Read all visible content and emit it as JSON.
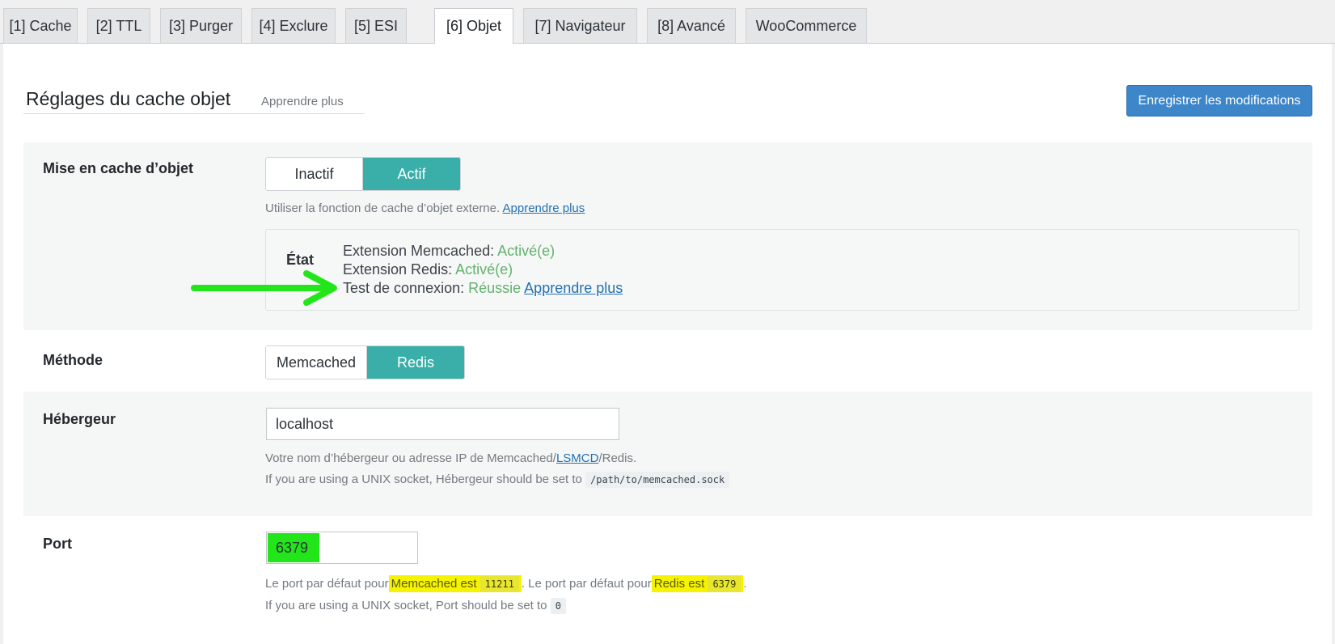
{
  "tabs": [
    {
      "label": "[1] Cache"
    },
    {
      "label": "[2] TTL"
    },
    {
      "label": "[3] Purger"
    },
    {
      "label": "[4] Exclure"
    },
    {
      "label": "[5] ESI"
    },
    {
      "label": "[6] Objet"
    },
    {
      "label": "[7] Navigateur"
    },
    {
      "label": "[8] Avancé"
    },
    {
      "label": "WooCommerce"
    }
  ],
  "active_tab": "[6] Objet",
  "header": {
    "title": "Réglages du cache objet",
    "learn_more": "Apprendre plus",
    "save_button": "Enregistrer les modifications"
  },
  "object_cache": {
    "label": "Mise en cache d’objet",
    "options": [
      "Inactif",
      "Actif"
    ],
    "selected": "Actif",
    "description": "Utiliser la fonction de cache d’objet externe.",
    "learn_more": "Apprendre plus",
    "status": {
      "title": "État",
      "memcached_label": "Extension Memcached:",
      "memcached_value": "Activé(e)",
      "redis_label": "Extension Redis:",
      "redis_value": "Activé(e)",
      "connection_label": "Test de connexion:",
      "connection_value": "Réussie",
      "learn_more": "Apprendre plus"
    }
  },
  "method": {
    "label": "Méthode",
    "options": [
      "Memcached",
      "Redis"
    ],
    "selected": "Redis"
  },
  "host": {
    "label": "Hébergeur",
    "value": "localhost",
    "desc_part1": "Votre nom d’hébergeur ou adresse IP de Memcached/",
    "desc_link": "LSMCD",
    "desc_part2": "/Redis.",
    "socket_text": "If you are using a UNIX socket, Hébergeur should be set to",
    "socket_code": "/path/to/memcached.sock"
  },
  "port": {
    "label": "Port",
    "value": "6379",
    "default_prefix": "Le port par défaut pour",
    "memcached_text": "Memcached est",
    "memcached_code": "11211",
    "middle_text": ". Le port par défaut pour",
    "redis_text": "Redis est",
    "redis_code": "6379",
    "end_text": ".",
    "socket_text": "If you are using a UNIX socket, Port should be set to",
    "socket_code": "0"
  },
  "colors": {
    "accent": "#3aaea9",
    "primary_button": "#3c86c9",
    "success": "#62b26c",
    "annotation_arrow": "#22e61a",
    "highlight_yellow": "#f5f300",
    "highlight_green": "#22e61a"
  }
}
